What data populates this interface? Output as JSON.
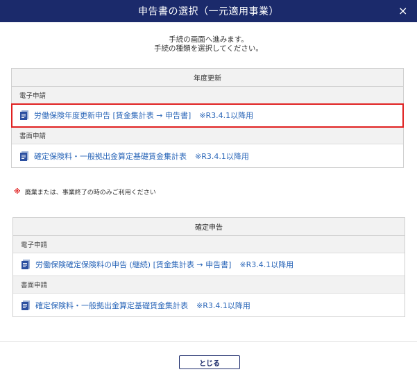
{
  "dialog": {
    "title": "申告書の選択（一元適用事業）",
    "close_glyph": "×"
  },
  "intro": {
    "line1": "手続の画面へ進みます。",
    "line2": "手続の種類を選択してください。"
  },
  "annual_update": {
    "header": "年度更新",
    "electronic_label": "電子申請",
    "electronic_item": {
      "label": "労働保険年度更新申告 [賃金集計表 → 申告書]",
      "note": "※R3.4.1以降用"
    },
    "paper_label": "書面申請",
    "paper_item": {
      "label": "確定保険料・一般拠出金算定基礎賃金集計表",
      "note": "※R3.4.1以降用"
    }
  },
  "notice": {
    "mark": "※",
    "text": "廃業または、事業終了の時のみご利用ください"
  },
  "final_return": {
    "header": "確定申告",
    "electronic_label": "電子申請",
    "electronic_item": {
      "label": "労働保険確定保険料の申告 (継続) [賃金集計表 → 申告書]",
      "note": "※R3.4.1以降用"
    },
    "paper_label": "書面申請",
    "paper_item": {
      "label": "確定保険料・一般拠出金算定基礎賃金集計表",
      "note": "※R3.4.1以降用"
    }
  },
  "footer": {
    "close_label": "とじる"
  },
  "colors": {
    "titlebar": "#1b2a6b",
    "link": "#2a66b8",
    "highlight": "#e02020"
  }
}
